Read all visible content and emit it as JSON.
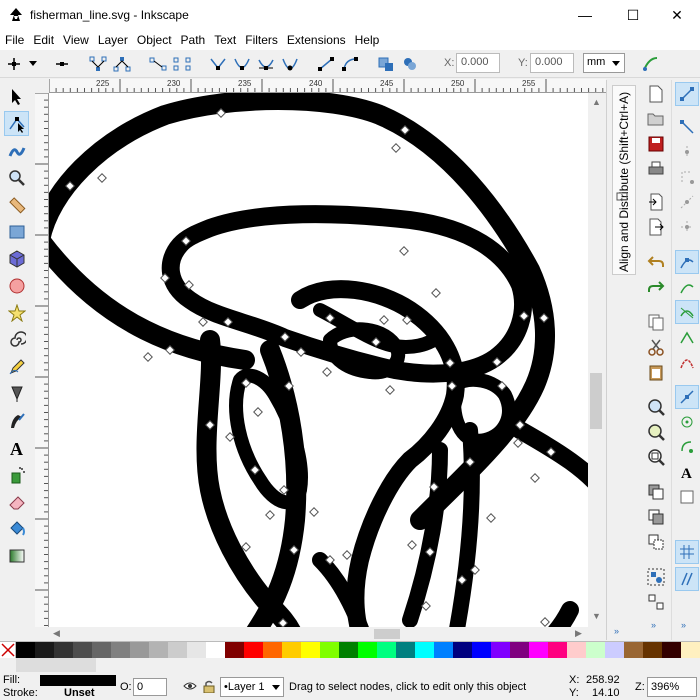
{
  "window": {
    "title": "fisherman_line.svg - Inkscape",
    "minimize": "—",
    "maximize": "☐",
    "close": "✕"
  },
  "menu": [
    "File",
    "Edit",
    "View",
    "Layer",
    "Object",
    "Path",
    "Text",
    "Filters",
    "Extensions",
    "Help"
  ],
  "node_toolbar": {
    "x_label": "X:",
    "x_value": "0.000",
    "y_label": "Y:",
    "y_value": "0.000",
    "unit": "mm"
  },
  "ruler": {
    "top_ticks": [
      "225",
      "230",
      "235",
      "240",
      "245",
      "250",
      "255"
    ],
    "left_ticks": [
      "115",
      "120",
      "125",
      "130",
      "135",
      "140",
      "145"
    ]
  },
  "dock": {
    "panel_title": "Align and Distribute (Shift+Ctrl+A)"
  },
  "palette": {
    "colors": [
      "#000000",
      "#1a1a1a",
      "#333333",
      "#4d4d4d",
      "#666666",
      "#808080",
      "#999999",
      "#b3b3b3",
      "#cccccc",
      "#e6e6e6",
      "#ffffff",
      "#800000",
      "#ff0000",
      "#ff6600",
      "#ffcc00",
      "#ffff00",
      "#80ff00",
      "#008000",
      "#00ff00",
      "#00ff80",
      "#008080",
      "#00ffff",
      "#0080ff",
      "#000080",
      "#0000ff",
      "#8000ff",
      "#800080",
      "#ff00ff",
      "#ff0080",
      "#ffcccc",
      "#ccffcc",
      "#ccccff",
      "#996633",
      "#663300",
      "#330000",
      "#fff0c0"
    ]
  },
  "status": {
    "fill_label": "Fill:",
    "stroke_label": "Stroke:",
    "stroke_value": "Unset",
    "opacity_label": "O:",
    "opacity_value": "0",
    "layer": "•Layer 1",
    "message": "Drag to select nodes, click to edit only this object",
    "x_label": "X:",
    "x_value": "258.92",
    "y_label": "Y:",
    "y_value": "14.10",
    "zoom_label": "Z:",
    "zoom_value": "396%"
  }
}
